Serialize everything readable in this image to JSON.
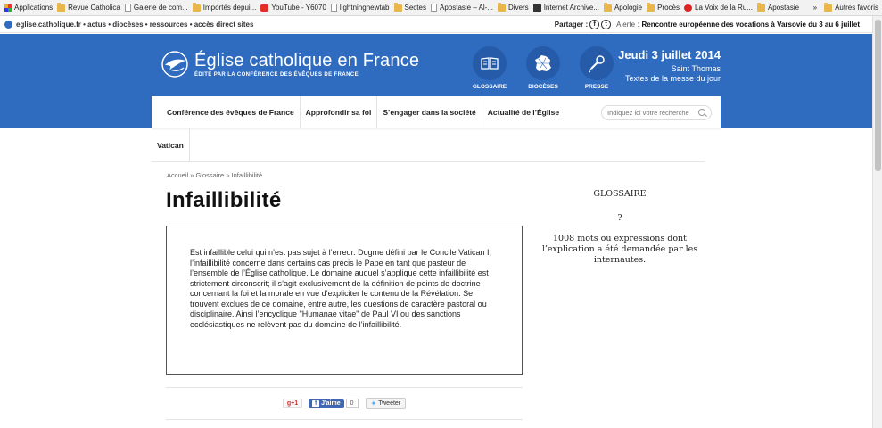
{
  "bookmarks": [
    {
      "label": "Applications",
      "icon": "grid-icon"
    },
    {
      "label": "Revue Catholica",
      "icon": "folder-icon"
    },
    {
      "label": "Galerie de com...",
      "icon": "page-icon"
    },
    {
      "label": "Importés depui...",
      "icon": "folder-icon"
    },
    {
      "label": "YouTube - Y6070",
      "icon": "youtube-icon"
    },
    {
      "label": "lightningnewtab",
      "icon": "page-icon"
    },
    {
      "label": "Sectes",
      "icon": "folder-icon"
    },
    {
      "label": "Apostasie – Al-...",
      "icon": "page-icon"
    },
    {
      "label": "Divers",
      "icon": "folder-icon"
    },
    {
      "label": "Internet Archive...",
      "icon": "archive-icon"
    },
    {
      "label": "Apologie",
      "icon": "folder-icon"
    },
    {
      "label": "Procès",
      "icon": "folder-icon"
    },
    {
      "label": "La Voix de la Ru...",
      "icon": "bubble-icon"
    },
    {
      "label": "Apostasie",
      "icon": "folder-icon"
    }
  ],
  "bookmarks_more": "»",
  "bookmarks_other": "Autres favoris",
  "sitebar": {
    "links": "eglise.catholique.fr • actus • diocèses • ressources • accès direct sites",
    "share_label": "Partager :",
    "alert_label": "Alerte :",
    "alert_text": "Rencontre européenne des vocations à Varsovie du 3 au 6 juillet"
  },
  "header": {
    "site_title": "Église catholique en France",
    "site_subtitle": "ÉDITÉ PAR LA CONFÉRENCE DES ÉVÊQUES DE FRANCE",
    "icons": [
      {
        "label": "GLOSSAIRE",
        "icon": "book-icon"
      },
      {
        "label": "DIOCÈSES",
        "icon": "france-map-icon"
      },
      {
        "label": "PRESSE",
        "icon": "microphone-icon"
      }
    ],
    "date": "Jeudi 3 juillet 2014",
    "saint": "Saint Thomas",
    "mass_link": "Textes de la messe du jour",
    "brand_color": "#2f6bbf"
  },
  "nav": {
    "items": [
      "Conférence des évêques de France",
      "Approfondir sa foi",
      "S’engager dans la société",
      "Actualité de l’Église"
    ],
    "second_row": [
      "Vatican"
    ],
    "search_placeholder": "Indiquez ici votre recherche"
  },
  "content": {
    "breadcrumb": "Accueil » Glossaire » Infaillibilité",
    "title": "Infaillibilité",
    "definition": "Est infaillible celui qui n’est pas sujet à l’erreur. Dogme défini par le Concile Vatican I, l’infaillibilité concerne dans certains cas précis le Pape en tant que pasteur de l’ensemble de l’Église catholique. Le domaine auquel s’applique cette infaillibilité est strictement circonscrit; il s’agit exclusivement de la définition de points de doctrine concernant la foi et la morale en vue d’expliciter le contenu de la Révélation. Se trouvent exclues de ce domaine, entre autre, les questions de caractère pastoral ou disciplinaire. Ainsi l’encyclique \"Humanae vitae\" de Paul VI ou des sanctions ecclésiastiques ne relèvent pas du domaine de l’infaillibilité."
  },
  "sidebar": {
    "title": "GLOSSAIRE",
    "question": "?",
    "description": "1008 mots ou expressions dont l’explication a été demandée par les internautes."
  },
  "share": {
    "gplus": "g+1",
    "fb_like": "J'aime",
    "fb_count": "0",
    "tweet": "Tweeter"
  }
}
